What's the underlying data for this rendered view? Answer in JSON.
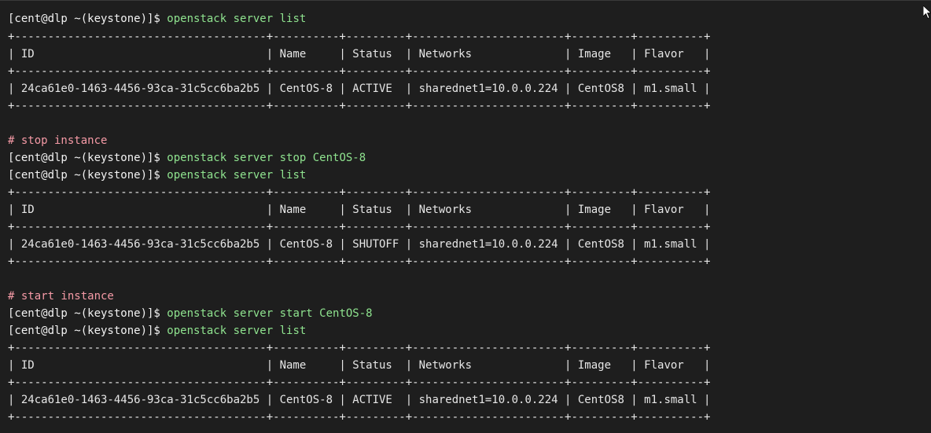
{
  "blocks": [
    {
      "prompt": "[cent@dlp ~(keystone)]$ ",
      "command": "openstack server list",
      "border": "+--------------------------------------+----------+---------+-----------------------+---------+----------+",
      "header": "| ID                                   | Name     | Status  | Networks              | Image   | Flavor   |",
      "row": "| 24ca61e0-1463-4456-93ca-31c5cc6ba2b5 | CentOS-8 | ACTIVE  | sharednet1=10.0.0.224 | CentOS8 | m1.small |"
    },
    {
      "comment": "# stop instance",
      "prompt": "[cent@dlp ~(keystone)]$ ",
      "command1": "openstack server stop CentOS-8",
      "command2": "openstack server list",
      "border": "+--------------------------------------+----------+---------+-----------------------+---------+----------+",
      "header": "| ID                                   | Name     | Status  | Networks              | Image   | Flavor   |",
      "row": "| 24ca61e0-1463-4456-93ca-31c5cc6ba2b5 | CentOS-8 | SHUTOFF | sharednet1=10.0.0.224 | CentOS8 | m1.small |"
    },
    {
      "comment": "# start instance",
      "prompt": "[cent@dlp ~(keystone)]$ ",
      "command1": "openstack server start CentOS-8",
      "command2": "openstack server list",
      "border": "+--------------------------------------+----------+---------+-----------------------+---------+----------+",
      "header": "| ID                                   | Name     | Status  | Networks              | Image   | Flavor   |",
      "row": "| 24ca61e0-1463-4456-93ca-31c5cc6ba2b5 | CentOS-8 | ACTIVE  | sharednet1=10.0.0.224 | CentOS8 | m1.small |"
    }
  ],
  "colors": {
    "background": "#1e1e1e",
    "text": "#e6e6e6",
    "command": "#8fe38f",
    "comment": "#f59aa6"
  },
  "cursor_icon": "mouse-pointer-icon"
}
